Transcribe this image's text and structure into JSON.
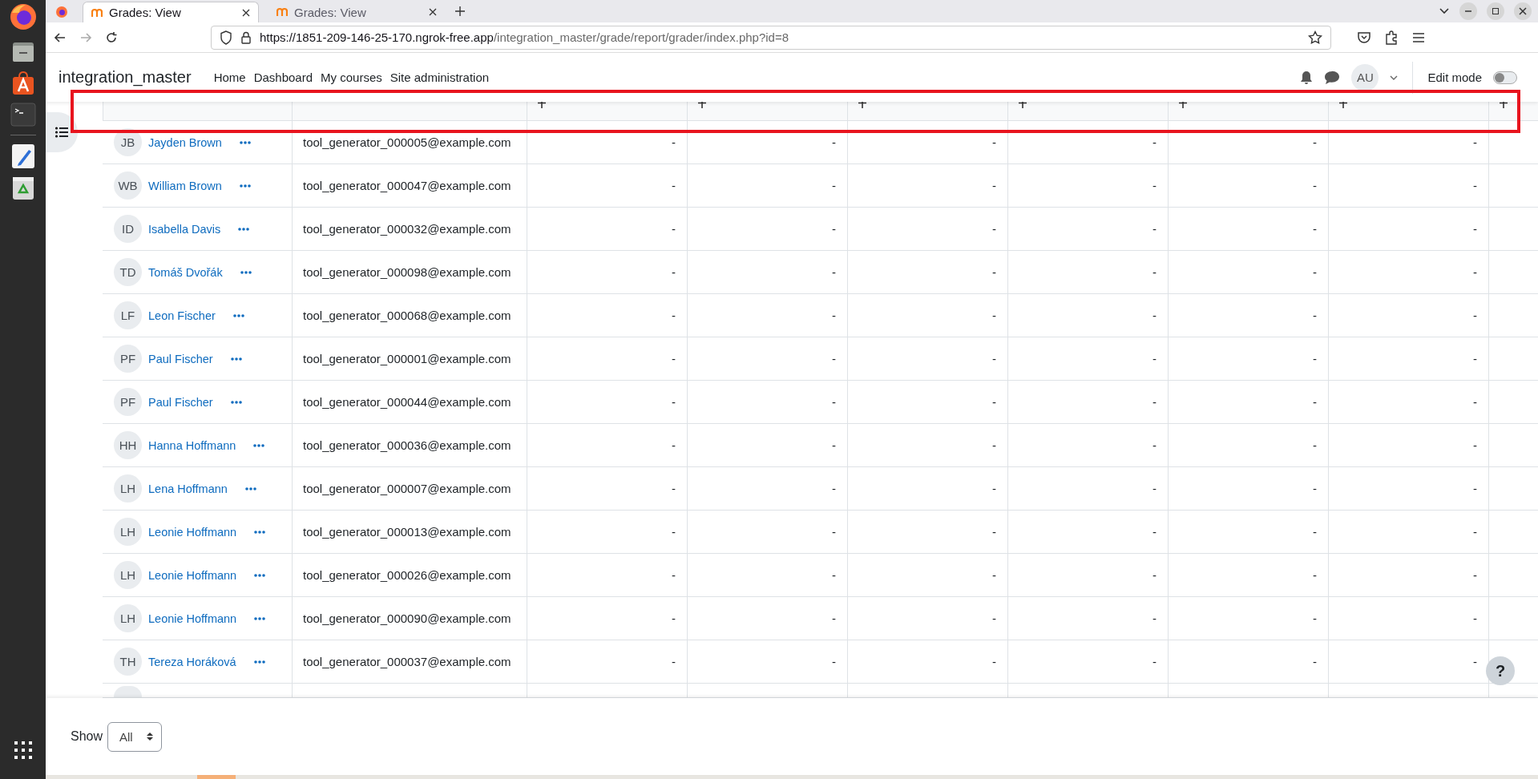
{
  "browser": {
    "tabs": [
      {
        "title": "Grades: View",
        "selected": true
      },
      {
        "title": "Grades: View",
        "selected": false
      }
    ],
    "url_host": "https://1851-209-146-25-170.ngrok-free.app",
    "url_path": "/integration_master/grade/report/grader/index.php?id=8"
  },
  "site": {
    "brand": "integration_master",
    "nav": [
      {
        "label": "Home"
      },
      {
        "label": "Dashboard"
      },
      {
        "label": "My courses"
      },
      {
        "label": "Site administration"
      }
    ],
    "user_initials": "AU",
    "edit_mode": {
      "label": "Edit mode",
      "on": false
    }
  },
  "table": {
    "rows": [
      {
        "initials": "JB",
        "name": "Jayden Brown",
        "email": "tool_generator_000005@example.com",
        "grades": [
          "-",
          "-",
          "-",
          "-",
          "-",
          "-"
        ]
      },
      {
        "initials": "WB",
        "name": "William Brown",
        "email": "tool_generator_000047@example.com",
        "grades": [
          "-",
          "-",
          "-",
          "-",
          "-",
          "-"
        ]
      },
      {
        "initials": "ID",
        "name": "Isabella Davis",
        "email": "tool_generator_000032@example.com",
        "grades": [
          "-",
          "-",
          "-",
          "-",
          "-",
          "-"
        ]
      },
      {
        "initials": "TD",
        "name": "Tomáš Dvořák",
        "email": "tool_generator_000098@example.com",
        "grades": [
          "-",
          "-",
          "-",
          "-",
          "-",
          "-"
        ]
      },
      {
        "initials": "LF",
        "name": "Leon Fischer",
        "email": "tool_generator_000068@example.com",
        "grades": [
          "-",
          "-",
          "-",
          "-",
          "-",
          "-"
        ]
      },
      {
        "initials": "PF",
        "name": "Paul Fischer",
        "email": "tool_generator_000001@example.com",
        "grades": [
          "-",
          "-",
          "-",
          "-",
          "-",
          "-"
        ]
      },
      {
        "initials": "PF",
        "name": "Paul Fischer",
        "email": "tool_generator_000044@example.com",
        "grades": [
          "-",
          "-",
          "-",
          "-",
          "-",
          "-"
        ]
      },
      {
        "initials": "HH",
        "name": "Hanna Hoffmann",
        "email": "tool_generator_000036@example.com",
        "grades": [
          "-",
          "-",
          "-",
          "-",
          "-",
          "-"
        ]
      },
      {
        "initials": "LH",
        "name": "Lena Hoffmann",
        "email": "tool_generator_000007@example.com",
        "grades": [
          "-",
          "-",
          "-",
          "-",
          "-",
          "-"
        ]
      },
      {
        "initials": "LH",
        "name": "Leonie Hoffmann",
        "email": "tool_generator_000013@example.com",
        "grades": [
          "-",
          "-",
          "-",
          "-",
          "-",
          "-"
        ]
      },
      {
        "initials": "LH",
        "name": "Leonie Hoffmann",
        "email": "tool_generator_000026@example.com",
        "grades": [
          "-",
          "-",
          "-",
          "-",
          "-",
          "-"
        ]
      },
      {
        "initials": "LH",
        "name": "Leonie Hoffmann",
        "email": "tool_generator_000090@example.com",
        "grades": [
          "-",
          "-",
          "-",
          "-",
          "-",
          "-"
        ]
      },
      {
        "initials": "TH",
        "name": "Tereza Horáková",
        "email": "tool_generator_000037@example.com",
        "grades": [
          "-",
          "-",
          "-",
          "-",
          "-",
          "-"
        ]
      }
    ]
  },
  "footer": {
    "label": "Show",
    "select_value": "All"
  },
  "help_button": "?"
}
